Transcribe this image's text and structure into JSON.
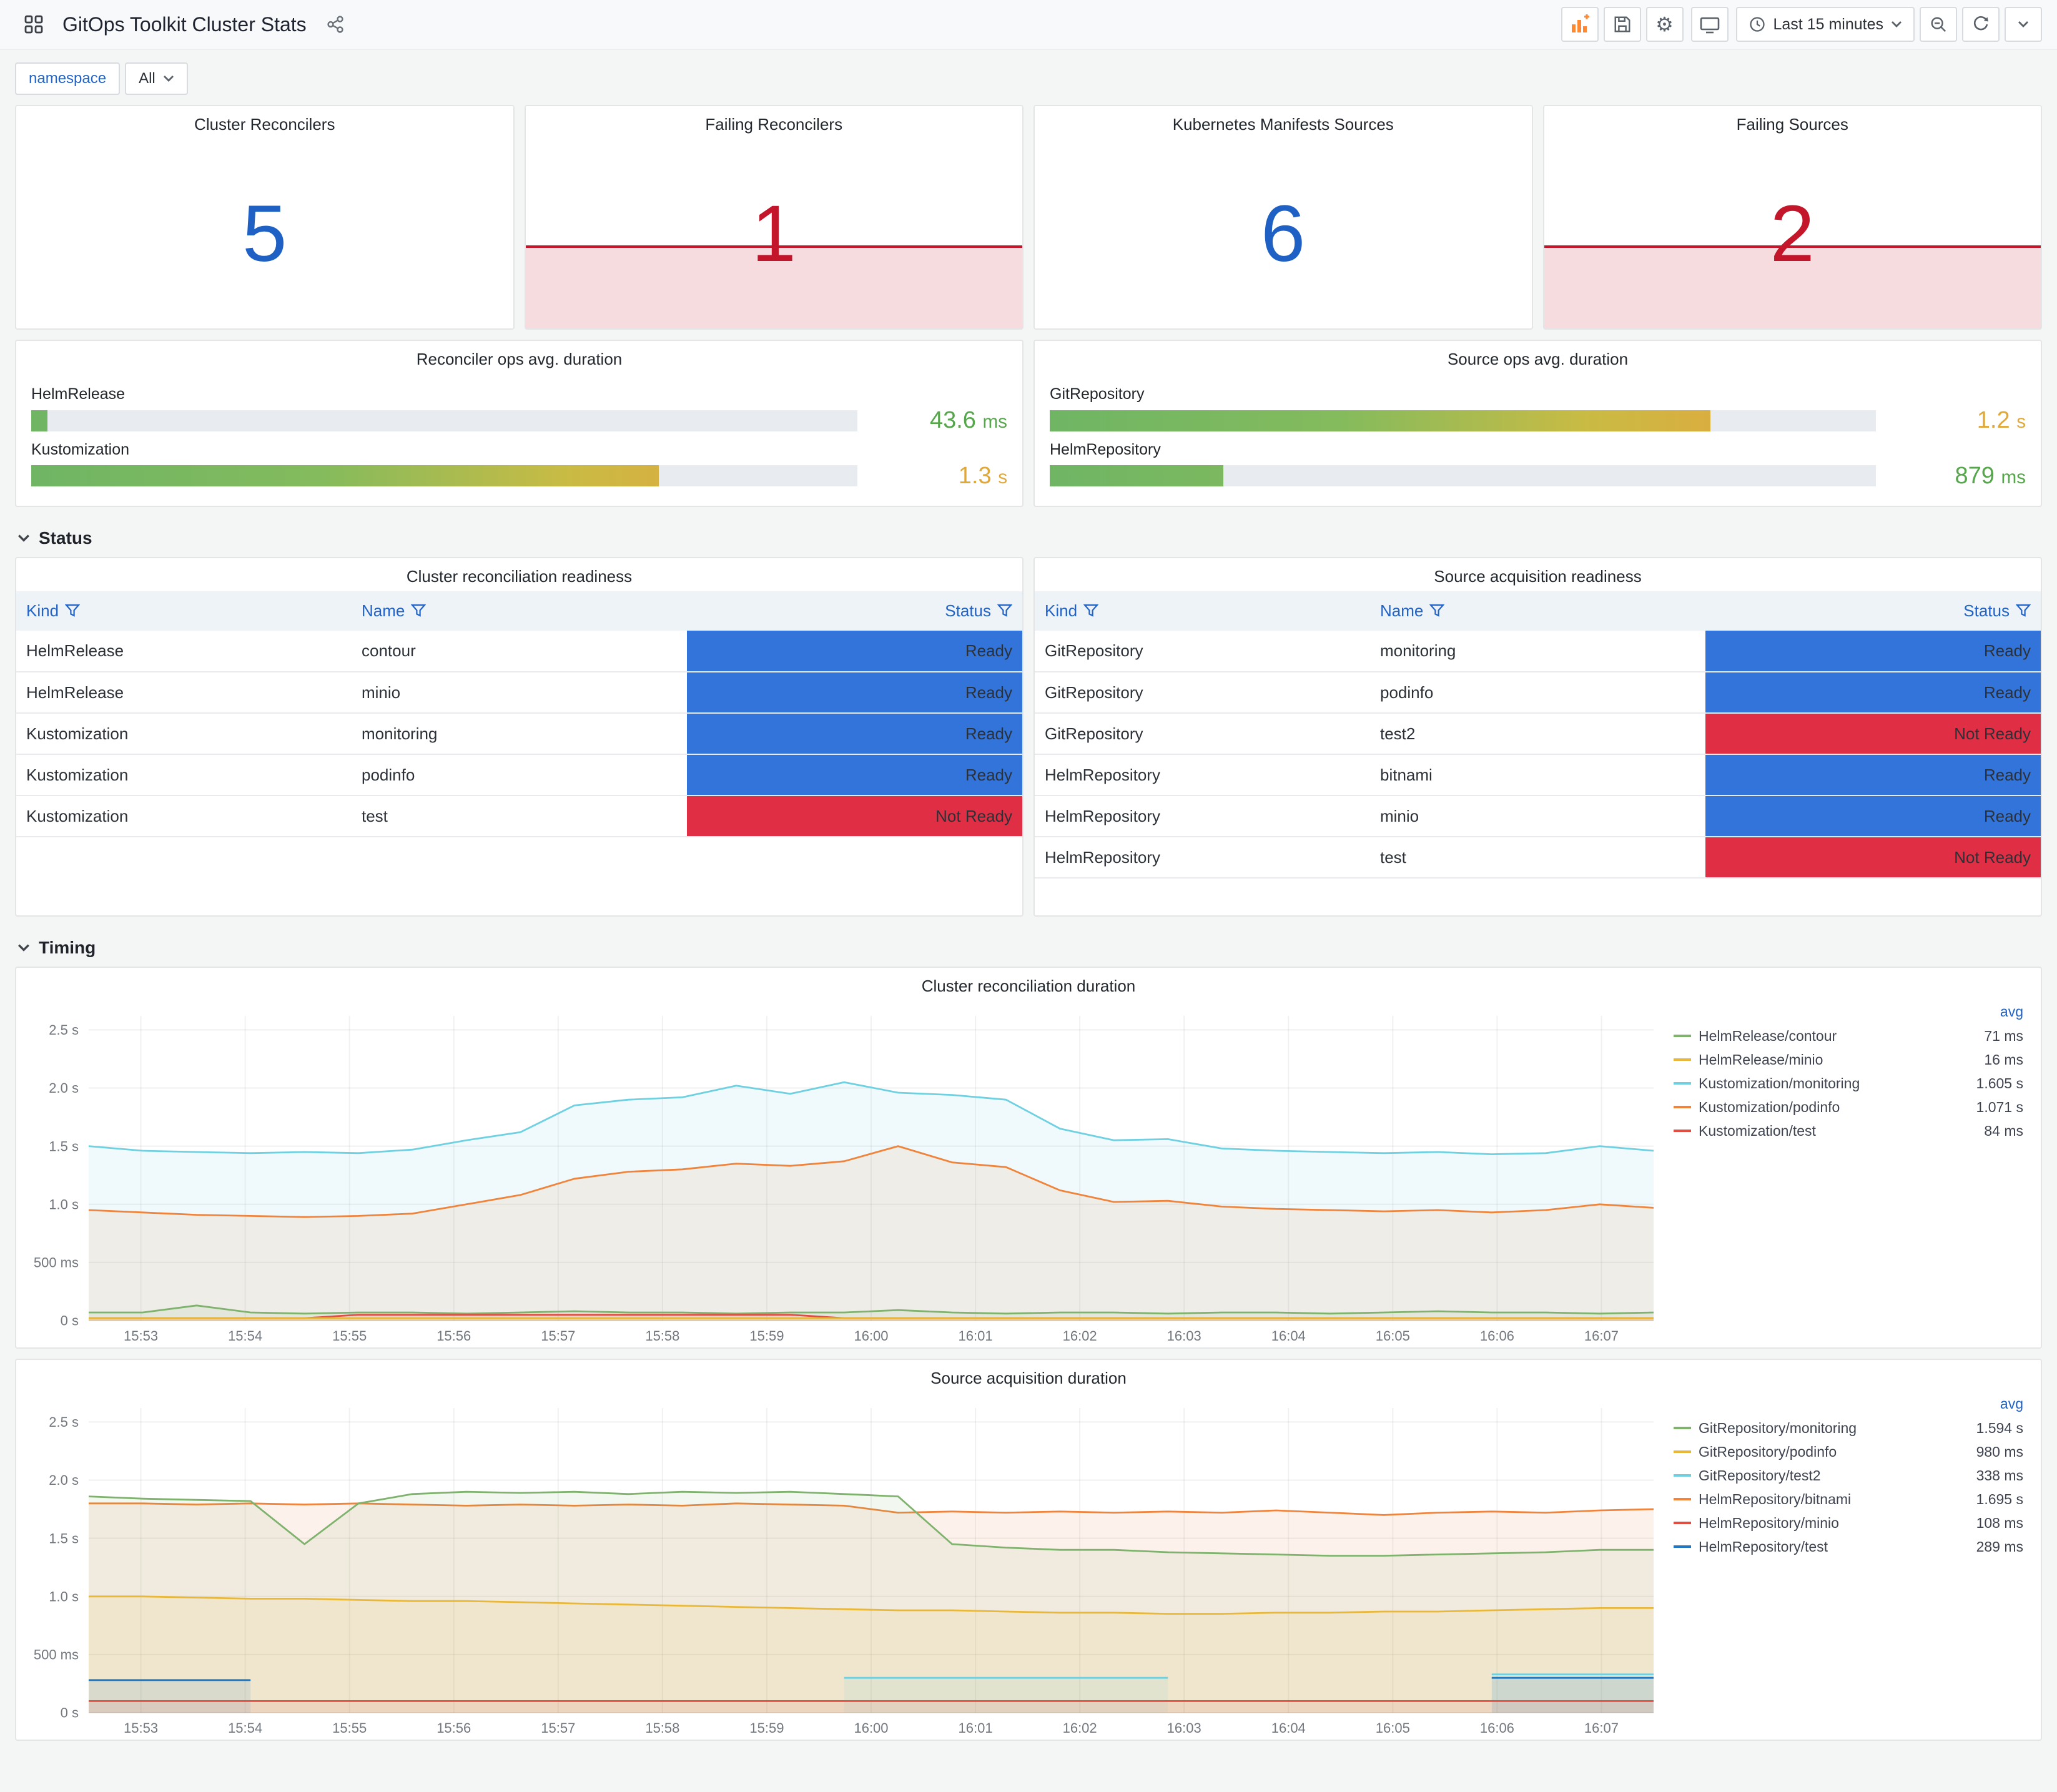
{
  "header": {
    "title": "GitOps Toolkit Cluster Stats",
    "time_range": "Last 15 minutes"
  },
  "variables": {
    "namespace_label": "namespace",
    "namespace_value": "All"
  },
  "icons": {
    "apps": "grid-squares",
    "share": "share-nodes",
    "add-panel": "bar-chart-plus",
    "save": "floppy-disk",
    "settings": "⚙",
    "tv": "monitor",
    "clock": "clock-face",
    "zoom-out": "magnifier-minus",
    "refresh": "circular-arrow",
    "chevron-down": "⌄",
    "filter": "funnel"
  },
  "colors": {
    "stat_blue": "#1F60C4",
    "stat_red": "#C4162A",
    "ready_blue": "#3274D9",
    "notready_red": "#E02F44",
    "value_green": "#56A64B",
    "value_amber": "#E0A838",
    "link_blue": "#2163c6"
  },
  "stats": [
    {
      "title": "Cluster Reconcilers",
      "value": "5",
      "value_color": "#1F60C4",
      "alert": false
    },
    {
      "title": "Failing Reconcilers",
      "value": "1",
      "value_color": "#C4162A",
      "alert": true
    },
    {
      "title": "Kubernetes Manifests Sources",
      "value": "6",
      "value_color": "#1F60C4",
      "alert": false
    },
    {
      "title": "Failing Sources",
      "value": "2",
      "value_color": "#C4162A",
      "alert": true
    }
  ],
  "gauges": [
    {
      "title": "Reconciler ops avg. duration",
      "rows": [
        {
          "label": "HelmRelease",
          "value": "43.6",
          "unit": "ms",
          "pct": 2,
          "value_color": "#56A64B"
        },
        {
          "label": "Kustomization",
          "value": "1.3",
          "unit": "s",
          "pct": 76,
          "value_color": "#E0A838"
        }
      ]
    },
    {
      "title": "Source ops avg. duration",
      "rows": [
        {
          "label": "GitRepository",
          "value": "1.2",
          "unit": "s",
          "pct": 80,
          "value_color": "#E0A838"
        },
        {
          "label": "HelmRepository",
          "value": "879",
          "unit": "ms",
          "pct": 21,
          "value_color": "#56A64B"
        }
      ]
    }
  ],
  "sections": {
    "status": "Status",
    "timing": "Timing"
  },
  "tables": [
    {
      "title": "Cluster reconciliation readiness",
      "columns": [
        "Kind",
        "Name",
        "Status"
      ],
      "rows": [
        [
          "HelmRelease",
          "contour",
          "Ready"
        ],
        [
          "HelmRelease",
          "minio",
          "Ready"
        ],
        [
          "Kustomization",
          "monitoring",
          "Ready"
        ],
        [
          "Kustomization",
          "podinfo",
          "Ready"
        ],
        [
          "Kustomization",
          "test",
          "Not Ready"
        ]
      ]
    },
    {
      "title": "Source acquisition readiness",
      "columns": [
        "Kind",
        "Name",
        "Status"
      ],
      "rows": [
        [
          "GitRepository",
          "monitoring",
          "Ready"
        ],
        [
          "GitRepository",
          "podinfo",
          "Ready"
        ],
        [
          "GitRepository",
          "test2",
          "Not Ready"
        ],
        [
          "HelmRepository",
          "bitnami",
          "Ready"
        ],
        [
          "HelmRepository",
          "minio",
          "Ready"
        ],
        [
          "HelmRepository",
          "test",
          "Not Ready"
        ]
      ]
    }
  ],
  "chart_data": [
    {
      "type": "line",
      "title": "Cluster reconciliation duration",
      "legend_header": "avg",
      "legend_position": "right",
      "grid": true,
      "ylim": [
        0,
        2.62
      ],
      "y_ticks": [
        {
          "v": 0,
          "label": "0 s"
        },
        {
          "v": 0.5,
          "label": "500 ms"
        },
        {
          "v": 1.0,
          "label": "1.0 s"
        },
        {
          "v": 1.5,
          "label": "1.5 s"
        },
        {
          "v": 2.0,
          "label": "2.0 s"
        },
        {
          "v": 2.5,
          "label": "2.5 s"
        }
      ],
      "x_ticks": [
        "15:53",
        "15:54",
        "15:55",
        "15:56",
        "15:57",
        "15:58",
        "15:59",
        "16:00",
        "16:01",
        "16:02",
        "16:03",
        "16:04",
        "16:05",
        "16:06",
        "16:07"
      ],
      "series": [
        {
          "name": "HelmRelease/contour",
          "avg": "71 ms",
          "color": "#7EB26D",
          "values": [
            0.07,
            0.07,
            0.13,
            0.07,
            0.06,
            0.07,
            0.07,
            0.06,
            0.07,
            0.08,
            0.07,
            0.07,
            0.06,
            0.07,
            0.07,
            0.09,
            0.07,
            0.06,
            0.07,
            0.07,
            0.06,
            0.07,
            0.07,
            0.06,
            0.07,
            0.08,
            0.07,
            0.07,
            0.06,
            0.07
          ]
        },
        {
          "name": "HelmRelease/minio",
          "avg": "16 ms",
          "color": "#EAB839",
          "values": [
            0.02,
            0.02,
            0.02,
            0.02,
            0.02,
            0.02,
            0.02,
            0.02,
            0.02,
            0.02,
            0.02,
            0.02,
            0.02,
            0.02,
            0.02,
            0.02,
            0.02,
            0.02,
            0.02,
            0.02,
            0.02,
            0.02,
            0.02,
            0.02,
            0.02,
            0.02,
            0.02,
            0.02,
            0.02,
            0.02
          ]
        },
        {
          "name": "Kustomization/monitoring",
          "avg": "1.605 s",
          "color": "#6ED0E0",
          "values": [
            1.5,
            1.46,
            1.45,
            1.44,
            1.45,
            1.44,
            1.47,
            1.55,
            1.62,
            1.85,
            1.9,
            1.92,
            2.02,
            1.95,
            2.05,
            1.96,
            1.94,
            1.9,
            1.65,
            1.55,
            1.56,
            1.48,
            1.46,
            1.45,
            1.44,
            1.45,
            1.43,
            1.44,
            1.5,
            1.46
          ]
        },
        {
          "name": "Kustomization/podinfo",
          "avg": "1.071 s",
          "color": "#EF843C",
          "values": [
            0.95,
            0.93,
            0.91,
            0.9,
            0.89,
            0.9,
            0.92,
            1.0,
            1.08,
            1.22,
            1.28,
            1.3,
            1.35,
            1.33,
            1.37,
            1.5,
            1.36,
            1.32,
            1.12,
            1.02,
            1.03,
            0.98,
            0.96,
            0.95,
            0.94,
            0.95,
            0.93,
            0.95,
            1.0,
            0.97
          ]
        },
        {
          "name": "Kustomization/test",
          "avg": "84 ms",
          "color": "#E24D42",
          "values": [
            0.02,
            0.02,
            0.02,
            0.02,
            0.02,
            0.05,
            0.05,
            0.05,
            0.05,
            0.05,
            0.05,
            0.05,
            0.05,
            0.05,
            0.02,
            0.02,
            0.02,
            0.02,
            0.02,
            0.02,
            0.02,
            0.02,
            0.02,
            0.02,
            0.02,
            0.02,
            0.02,
            0.02,
            0.02,
            0.02
          ]
        }
      ]
    },
    {
      "type": "line",
      "title": "Source acquisition duration",
      "legend_header": "avg",
      "legend_position": "right",
      "grid": true,
      "ylim": [
        0,
        2.62
      ],
      "y_ticks": [
        {
          "v": 0,
          "label": "0 s"
        },
        {
          "v": 0.5,
          "label": "500 ms"
        },
        {
          "v": 1.0,
          "label": "1.0 s"
        },
        {
          "v": 1.5,
          "label": "1.5 s"
        },
        {
          "v": 2.0,
          "label": "2.0 s"
        },
        {
          "v": 2.5,
          "label": "2.5 s"
        }
      ],
      "x_ticks": [
        "15:53",
        "15:54",
        "15:55",
        "15:56",
        "15:57",
        "15:58",
        "15:59",
        "16:00",
        "16:01",
        "16:02",
        "16:03",
        "16:04",
        "16:05",
        "16:06",
        "16:07"
      ],
      "series": [
        {
          "name": "GitRepository/monitoring",
          "avg": "1.594 s",
          "color": "#7EB26D",
          "values": [
            1.86,
            1.84,
            1.83,
            1.82,
            1.45,
            1.8,
            1.88,
            1.9,
            1.89,
            1.9,
            1.88,
            1.9,
            1.89,
            1.9,
            1.88,
            1.86,
            1.45,
            1.42,
            1.4,
            1.4,
            1.38,
            1.37,
            1.36,
            1.35,
            1.35,
            1.36,
            1.37,
            1.38,
            1.4,
            1.4
          ]
        },
        {
          "name": "GitRepository/podinfo",
          "avg": "980 ms",
          "color": "#EAB839",
          "values": [
            1.0,
            1.0,
            0.99,
            0.98,
            0.98,
            0.97,
            0.96,
            0.96,
            0.95,
            0.94,
            0.93,
            0.92,
            0.91,
            0.9,
            0.89,
            0.88,
            0.88,
            0.87,
            0.86,
            0.86,
            0.85,
            0.85,
            0.86,
            0.86,
            0.87,
            0.87,
            0.88,
            0.89,
            0.9,
            0.9
          ]
        },
        {
          "name": "GitRepository/test2",
          "avg": "338 ms",
          "color": "#6ED0E0",
          "values": [
            null,
            null,
            null,
            null,
            null,
            null,
            null,
            null,
            null,
            null,
            null,
            null,
            null,
            null,
            0.3,
            0.3,
            0.3,
            0.3,
            0.3,
            0.3,
            0.3,
            null,
            null,
            null,
            null,
            null,
            0.33,
            0.33,
            0.33,
            0.33
          ]
        },
        {
          "name": "HelmRepository/bitnami",
          "avg": "1.695 s",
          "color": "#EF843C",
          "values": [
            1.8,
            1.8,
            1.79,
            1.8,
            1.79,
            1.8,
            1.79,
            1.78,
            1.79,
            1.78,
            1.79,
            1.78,
            1.8,
            1.79,
            1.78,
            1.72,
            1.73,
            1.72,
            1.73,
            1.72,
            1.73,
            1.72,
            1.74,
            1.72,
            1.7,
            1.72,
            1.73,
            1.72,
            1.74,
            1.75
          ]
        },
        {
          "name": "HelmRepository/minio",
          "avg": "108 ms",
          "color": "#E24D42",
          "values": [
            0.1,
            0.1,
            0.1,
            0.1,
            0.1,
            0.1,
            0.1,
            0.1,
            0.1,
            0.1,
            0.1,
            0.1,
            0.1,
            0.1,
            0.1,
            0.1,
            0.1,
            0.1,
            0.1,
            0.1,
            0.1,
            0.1,
            0.1,
            0.1,
            0.1,
            0.1,
            0.1,
            0.1,
            0.1,
            0.1
          ]
        },
        {
          "name": "HelmRepository/test",
          "avg": "289 ms",
          "color": "#1F78C1",
          "values": [
            0.28,
            0.28,
            0.28,
            0.28,
            null,
            null,
            null,
            null,
            null,
            null,
            null,
            null,
            null,
            null,
            null,
            null,
            null,
            null,
            null,
            null,
            null,
            null,
            null,
            null,
            null,
            null,
            0.3,
            0.3,
            0.3,
            0.3
          ]
        }
      ]
    }
  ]
}
